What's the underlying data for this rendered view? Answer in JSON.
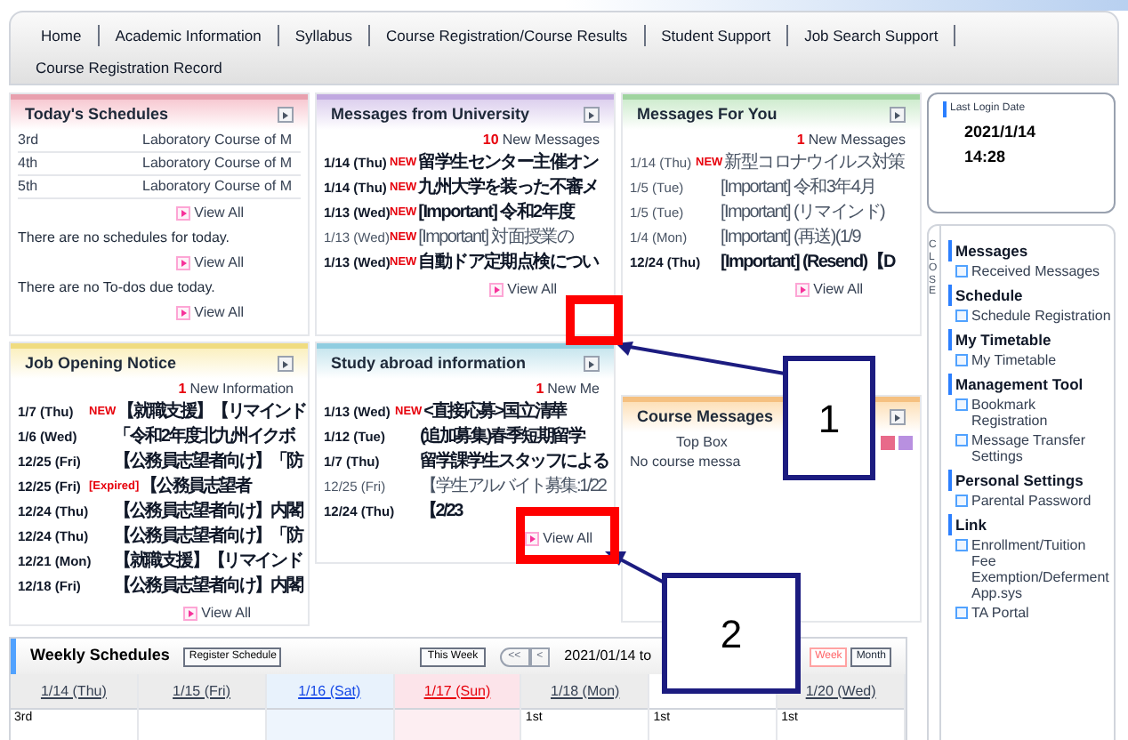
{
  "nav": {
    "items": [
      {
        "label": "Home"
      },
      {
        "label": "Academic Information"
      },
      {
        "label": "Syllabus"
      },
      {
        "label": "Course Registration/Course Results"
      },
      {
        "label": "Student Support"
      },
      {
        "label": "Job Search Support"
      }
    ],
    "second_row": [
      {
        "label": "Course Registration Record"
      }
    ]
  },
  "todays_schedules": {
    "title": "Today's Schedules",
    "rows": [
      {
        "period": "3rd",
        "course": "Laboratory Course of M"
      },
      {
        "period": "4th",
        "course": "Laboratory Course of M"
      },
      {
        "period": "5th",
        "course": "Laboratory Course of M"
      }
    ],
    "view_all_1": "View All",
    "no_schedules": "There are no schedules for today.",
    "view_all_2": "View All",
    "no_todos": "There are no To-dos due today.",
    "view_all_3": "View All"
  },
  "messages_from_university": {
    "title": "Messages from University",
    "count": "10",
    "count_label": "New Messages",
    "rows": [
      {
        "date": "1/14 (Thu)",
        "badge": "NEW",
        "text": "留学生センター主催オン",
        "unread": true
      },
      {
        "date": "1/14 (Thu)",
        "badge": "NEW",
        "text": "九州大学を装った不審メ",
        "unread": true
      },
      {
        "date": "1/13 (Wed)",
        "badge": "NEW",
        "text": "[Important] 令和2年度",
        "unread": true
      },
      {
        "date": "1/13 (Wed)",
        "badge": "NEW",
        "text": "[Important] 対面授業の",
        "unread": false
      },
      {
        "date": "1/13 (Wed)",
        "badge": "NEW",
        "text": "自動ドア定期点検につい",
        "unread": true
      }
    ],
    "view_all": "View All"
  },
  "messages_for_you": {
    "title": "Messages For You",
    "count": "1",
    "count_label": "New Messages",
    "rows": [
      {
        "date": "1/14 (Thu)",
        "badge": "NEW",
        "text": "新型コロナウイルス対策",
        "unread": false
      },
      {
        "date": "1/5 (Tue)",
        "text": "[Important] 令和3年4月",
        "unread": false
      },
      {
        "date": "1/5 (Tue)",
        "text": "[Important] (リマインド)",
        "unread": false
      },
      {
        "date": "1/4 (Mon)",
        "text": "[Important] (再送)(1/9",
        "unread": false
      },
      {
        "date": "12/24 (Thu)",
        "text": "[Important] (Resend)【D",
        "unread": true
      }
    ],
    "view_all": "View All"
  },
  "job_opening_notice": {
    "title": "Job Opening Notice",
    "count": "1",
    "count_label": "New Information",
    "rows": [
      {
        "date": "1/7 (Thu)",
        "badge": "NEW",
        "text": "【就職支援】【リマインド",
        "unread": true
      },
      {
        "date": "1/6 (Wed)",
        "text": "「令和2年度北九州イクボ",
        "unread": true
      },
      {
        "date": "12/25 (Fri)",
        "text": "【公務員志望者向け】「防",
        "unread": true
      },
      {
        "date": "12/25 (Fri)",
        "badge": "[Expired]",
        "text": "【公務員志望者",
        "unread": true
      },
      {
        "date": "12/24 (Thu)",
        "text": "【公務員志望者向け】内閣",
        "unread": true
      },
      {
        "date": "12/24 (Thu)",
        "text": "【公務員志望者向け】「防",
        "unread": true
      },
      {
        "date": "12/21 (Mon)",
        "text": "【就職支援】【リマインド",
        "unread": true
      },
      {
        "date": "12/18 (Fri)",
        "text": "【公務員志望者向け】内閣",
        "unread": true
      }
    ],
    "view_all": "View All"
  },
  "study_abroad_information": {
    "title": "Study abroad information",
    "count": "1",
    "count_label": "New Me",
    "rows": [
      {
        "date": "1/13 (Wed)",
        "badge": "NEW",
        "text": "<直接応募>国立清華",
        "unread": true
      },
      {
        "date": "1/12 (Tue)",
        "text": "(追加募集)春季短期留学",
        "unread": true
      },
      {
        "date": "1/7 (Thu)",
        "text": "留学課学生スタッフによる",
        "unread": true
      },
      {
        "date": "12/25 (Fri)",
        "text": "【学生アルバイト募集:1/22",
        "unread": false
      },
      {
        "date": "12/24 (Thu)",
        "text": "【2/23",
        "unread": true
      }
    ],
    "view_all": "View All"
  },
  "course_messages": {
    "title": "Course Messages",
    "top_box": "Top Box",
    "message": "No course messa"
  },
  "login_info": {
    "label": "Last Login Date",
    "date": "2021/1/14",
    "time": "14:28"
  },
  "side_menu": {
    "close": "CLOSE",
    "sections": [
      {
        "title": "Messages",
        "links": [
          "Received Messages"
        ]
      },
      {
        "title": "Schedule",
        "links": [
          "Schedule Registration"
        ]
      },
      {
        "title": "My Timetable",
        "links": [
          "My Timetable"
        ]
      },
      {
        "title": "Management Tool",
        "links": [
          "Bookmark Registration",
          "Message Transfer Settings"
        ]
      },
      {
        "title": "Personal Settings",
        "links": [
          "Parental Password"
        ]
      },
      {
        "title": "Link",
        "links": [
          "Enrollment/Tuition Fee Exemption/Deferment App.sys",
          "TA Portal"
        ]
      }
    ]
  },
  "weekly_schedules": {
    "title": "Weekly Schedules",
    "register": "Register Schedule",
    "this_week": "This Week",
    "prev_far": "<<",
    "prev": "<",
    "range": "2021/01/14 to",
    "views": [
      {
        "label": "Week",
        "selected": true
      },
      {
        "label": "Month",
        "selected": false
      }
    ],
    "days": [
      {
        "label": "1/14 (Thu)",
        "kind": "weekday",
        "first": "3rd"
      },
      {
        "label": "1/15 (Fri)",
        "kind": "weekday"
      },
      {
        "label": "1/16 (Sat)",
        "kind": "saturday"
      },
      {
        "label": "1/17 (Sun)",
        "kind": "sunday"
      },
      {
        "label": "1/18 (Mon)",
        "kind": "weekday",
        "first": "1st"
      },
      {
        "kind": "hidden",
        "first": "1st"
      },
      {
        "label": "1/20 (Wed)",
        "kind": "weekday",
        "first": "1st"
      }
    ]
  },
  "annotations": [
    {
      "label": "1"
    },
    {
      "label": "2"
    }
  ]
}
